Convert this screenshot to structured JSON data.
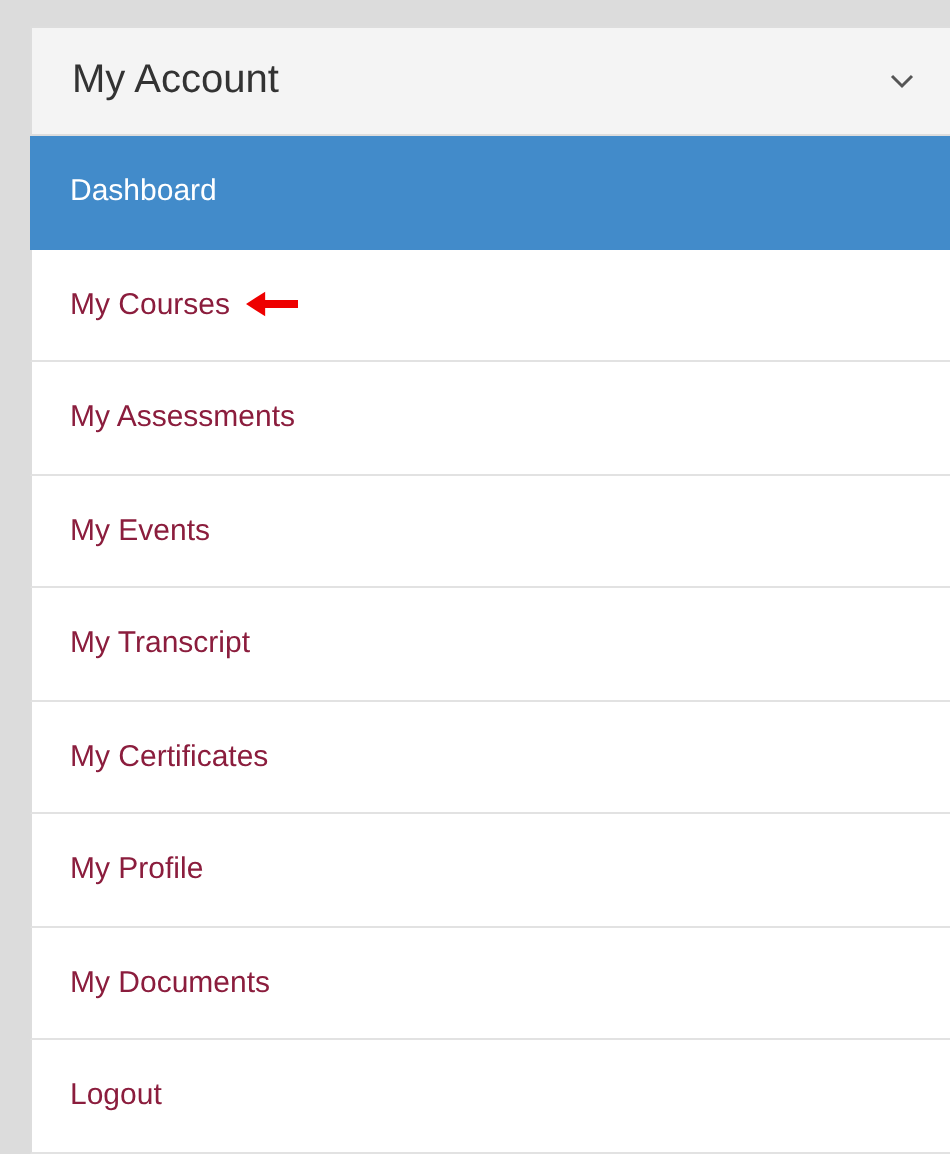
{
  "panel": {
    "title": "My Account",
    "expanded": true
  },
  "items": [
    {
      "label": "Dashboard",
      "selected": true,
      "arrow": false
    },
    {
      "label": "My Courses",
      "selected": false,
      "arrow": true
    },
    {
      "label": "My Assessments",
      "selected": false,
      "arrow": false
    },
    {
      "label": "My Events",
      "selected": false,
      "arrow": false
    },
    {
      "label": "My Transcript",
      "selected": false,
      "arrow": false
    },
    {
      "label": "My Certificates",
      "selected": false,
      "arrow": false
    },
    {
      "label": "My Profile",
      "selected": false,
      "arrow": false
    },
    {
      "label": "My Documents",
      "selected": false,
      "arrow": false
    },
    {
      "label": "Logout",
      "selected": false,
      "arrow": false
    }
  ]
}
